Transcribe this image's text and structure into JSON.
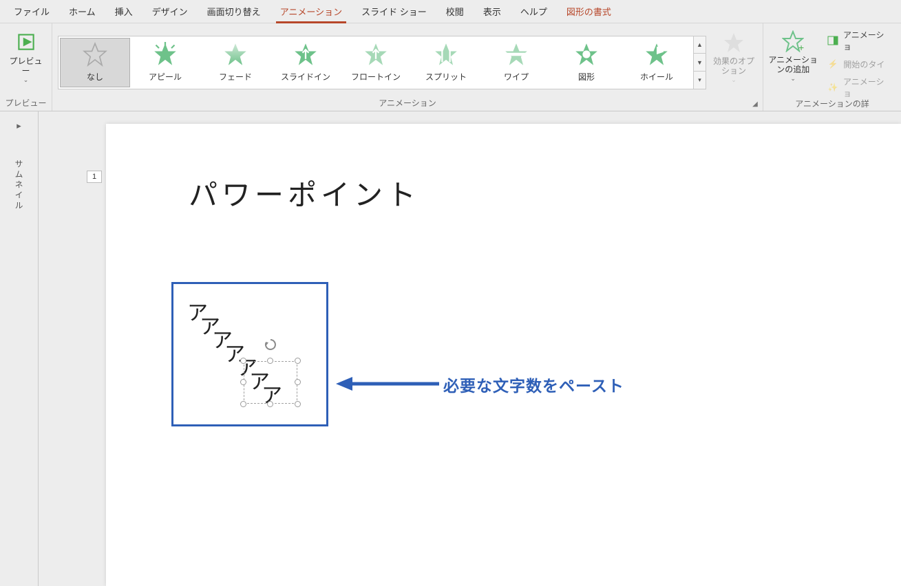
{
  "tabs": {
    "file": "ファイル",
    "home": "ホーム",
    "insert": "挿入",
    "design": "デザイン",
    "transition": "画面切り替え",
    "animation": "アニメーション",
    "slideshow": "スライド ショー",
    "review": "校閲",
    "view": "表示",
    "help": "ヘルプ",
    "format": "図形の書式"
  },
  "ribbon": {
    "preview_group": "プレビュー",
    "preview_btn": "プレビュー",
    "anim_group": "アニメーション",
    "effects": [
      "なし",
      "アピール",
      "フェード",
      "スライドイン",
      "フロートイン",
      "スプリット",
      "ワイプ",
      "図形",
      "ホイール"
    ],
    "effect_options": "効果のオプション",
    "add_anim": "アニメーションの追加",
    "pane": "アニメーショ",
    "trigger": "開始のタイ",
    "painter": "アニメーショ",
    "detail_group": "アニメーションの詳"
  },
  "sidebar": {
    "label": "サムネイル"
  },
  "slide": {
    "page": "1",
    "title": "パワーポイント",
    "glyph": "ア",
    "callout": "必要な文字数をペースト"
  }
}
